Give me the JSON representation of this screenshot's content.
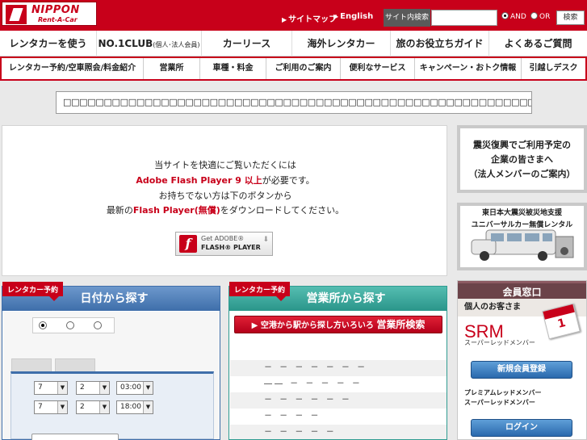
{
  "header": {
    "logo_name": "NIPPON",
    "logo_sub": "Rent-A-Car",
    "sitemap": "サイトマップ",
    "english": "English",
    "search_label": "サイト内検索",
    "search_placeholder": "",
    "and_label": "AND",
    "or_label": "OR",
    "search_button": "検索"
  },
  "global_nav": [
    {
      "label": "レンタカーを使う"
    },
    {
      "label": "NO.1CLUB",
      "small": "(個人･法人会員)"
    },
    {
      "label": "カーリース"
    },
    {
      "label": "海外レンタカー"
    },
    {
      "label": "旅のお役立ちガイド"
    },
    {
      "label": "よくあるご質問"
    }
  ],
  "sub_nav": [
    {
      "label": "レンタカー予約/空車照会/料金紹介"
    },
    {
      "label": "営業所"
    },
    {
      "label": "車種・料金"
    },
    {
      "label": "ご利用のご案内"
    },
    {
      "label": "便利なサービス"
    },
    {
      "label": "キャンペーン・おトク情報"
    },
    {
      "label": "引越しデスク"
    }
  ],
  "notice": "□□□□□□□□□□□□□□□□□□□□□□□□□□□□□□□□□□□□□□□□□□□□□□□□□□□□□□□□□□□□□□□□□",
  "flash": {
    "line1": "当サイトを快適にご覧いただくには",
    "line2_red": "Adobe Flash Player 9 以上",
    "line2_rest": "が必要です。",
    "line3": "お持ちでない方は下のボタンから",
    "line4_pre": "最新の",
    "line4_red": "Flash Player(無償)",
    "line4_post": "をダウンロードしてください。",
    "button_top": "Get ADOBE®",
    "button_bottom": "FLASH® PLAYER"
  },
  "banners": {
    "quake_line1": "震災復興でご利用予定の",
    "quake_line2": "企業の皆さまへ",
    "quake_line3": "（法人メンバーのご案内）",
    "vehicle_line1": "東日本大震災被災地支援",
    "vehicle_line2": "ユニバーサルカー無償レンタル"
  },
  "member": {
    "title": "会員窓口",
    "sub": "個人のお客さま",
    "srm": "SRM",
    "srm_sub": "スーパーレッドメンバー",
    "register": "新規会員登録",
    "premium_line1": "プレミアムレッドメンバー",
    "premium_line2": "スーパーレッドメンバー",
    "login": "ログイン"
  },
  "date_panel": {
    "tag": "レンタカー予約",
    "title": "日付から探す",
    "row1": {
      "month": "7",
      "day": "2",
      "time": "03:00"
    },
    "row2": {
      "month": "7",
      "day": "2",
      "time": "18:00"
    }
  },
  "office_panel": {
    "tag": "レンタカー予約",
    "title": "営業所から探す",
    "button_small": "空港から駅から探し方いろいろ",
    "button_big": "営業所検索",
    "rows": [
      "",
      "－ － － － － － －",
      "―― － － － － －",
      "－ － － － － －",
      "－ － － －",
      "－ － － － －"
    ]
  },
  "colors": {
    "brand_red": "#c8001a",
    "date_blue": "#3e6eaa",
    "office_teal": "#2a958a",
    "member_header": "#6b4349"
  }
}
